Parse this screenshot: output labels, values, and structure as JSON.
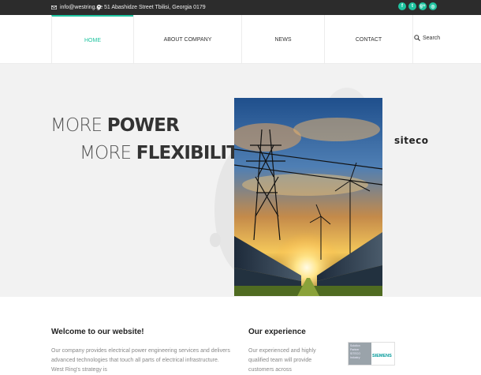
{
  "topbar": {
    "email": "info@westring.ge",
    "address": "51 Abashidze Street Tbilisi, Georgia 0179",
    "social": [
      {
        "icon": "facebook-icon",
        "glyph": "f"
      },
      {
        "icon": "twitter-icon",
        "glyph": "t"
      },
      {
        "icon": "google-plus-icon",
        "glyph": "g+"
      },
      {
        "icon": "instagram-icon",
        "glyph": "◎"
      }
    ]
  },
  "nav": {
    "items": [
      {
        "label": "HOME",
        "active": true
      },
      {
        "label": "ABOUT COMPANY",
        "active": false
      },
      {
        "label": "NEWS",
        "active": false
      },
      {
        "label": "CONTACT",
        "active": false
      }
    ],
    "search_label": "Search"
  },
  "hero": {
    "line1_light": "MORE ",
    "line1_bold": "POWER",
    "line2_light": "MORE ",
    "line2_bold": "FLEXIBILITY",
    "brand": "siteco"
  },
  "welcome": {
    "title": "Welcome to our website!",
    "text": "Our company provides electrical power engineering services and delivers advanced technologies that touch all parts of electrical infrastructure. West Ring's strategy is"
  },
  "experience": {
    "title": "Our experience",
    "text": "Our experienced and highly qualified team will provide customers across",
    "partner_left": "Solution Partner SITECO Industry",
    "partner_right": "SIEMENS"
  },
  "colors": {
    "accent": "#1fc4a0",
    "topbar": "#2c2c2c",
    "hero_bg": "#f2f2f2"
  }
}
